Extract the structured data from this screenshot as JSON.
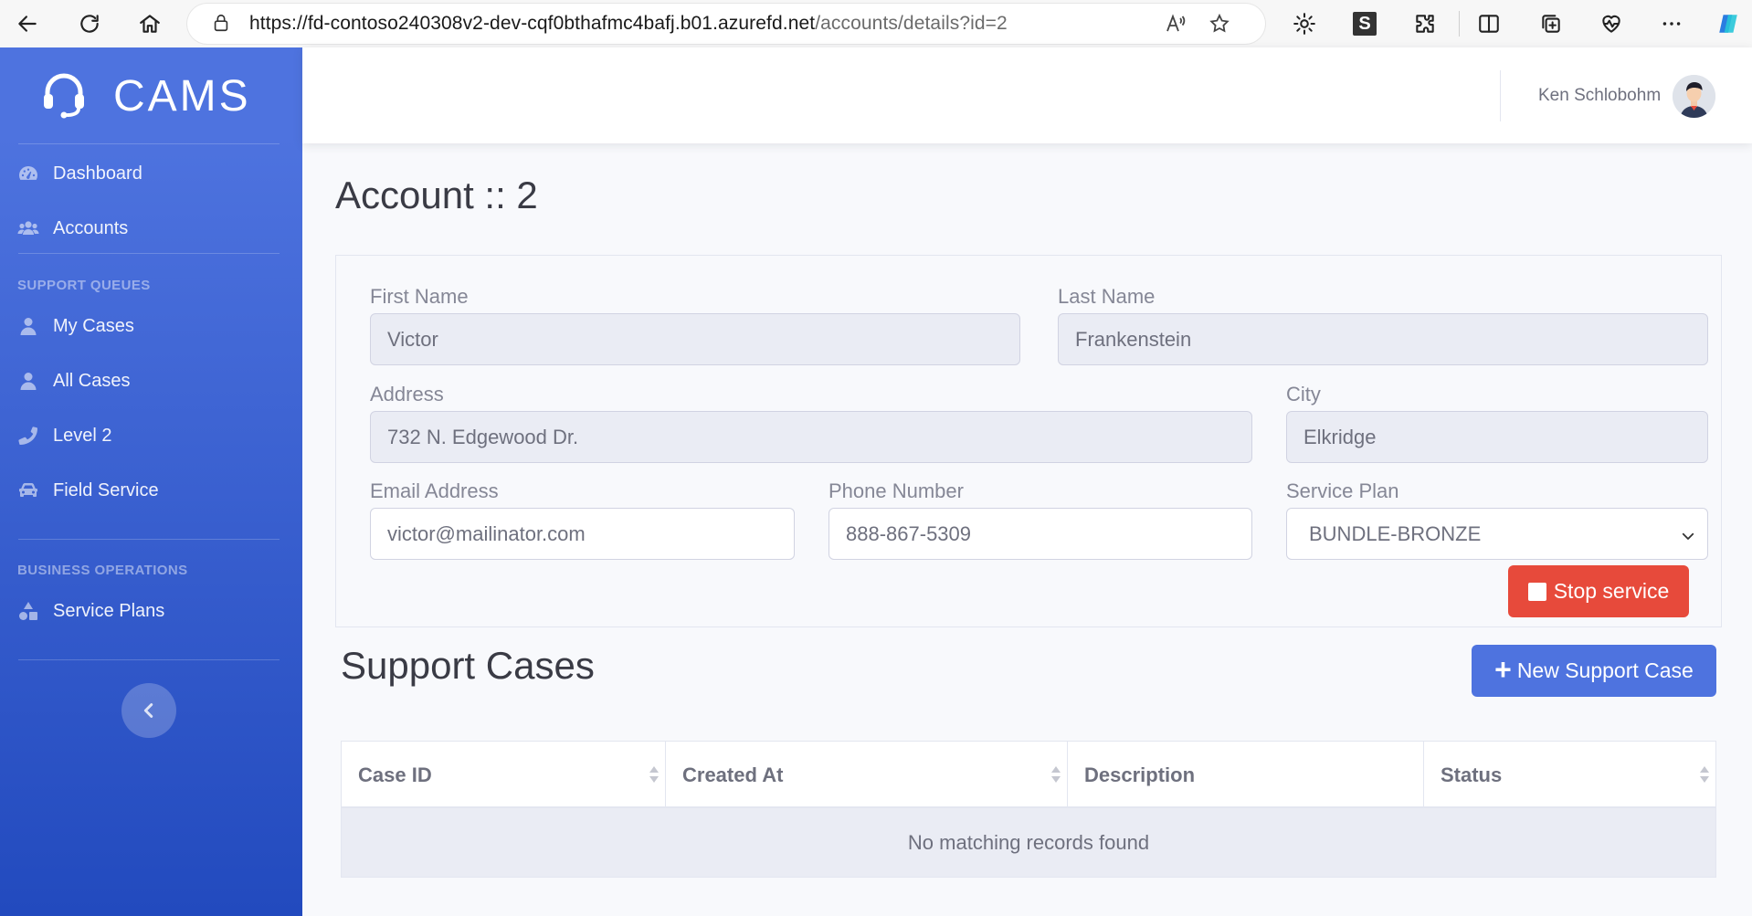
{
  "browser": {
    "url_host": "https://fd-contoso240308v2-dev-cqf0bthafmc4bafj.b01.azurefd.net",
    "url_path": "/accounts/details?id=2",
    "s_extension_label": "S"
  },
  "sidebar": {
    "brand": "CAMS",
    "items": [
      {
        "label": "Dashboard",
        "icon": "tachometer-icon"
      },
      {
        "label": "Accounts",
        "icon": "users-icon"
      }
    ],
    "support_heading": "SUPPORT QUEUES",
    "support_items": [
      {
        "label": "My Cases",
        "icon": "user-icon"
      },
      {
        "label": "All Cases",
        "icon": "user-icon"
      },
      {
        "label": "Level 2",
        "icon": "phone-icon"
      },
      {
        "label": "Field Service",
        "icon": "car-icon"
      }
    ],
    "business_heading": "BUSINESS OPERATIONS",
    "business_items": [
      {
        "label": "Service Plans",
        "icon": "shapes-icon"
      }
    ]
  },
  "topbar": {
    "user_name": "Ken Schlobohm"
  },
  "page": {
    "title": "Account :: 2"
  },
  "form": {
    "first_name_label": "First Name",
    "first_name_value": "Victor",
    "last_name_label": "Last Name",
    "last_name_value": "Frankenstein",
    "address_label": "Address",
    "address_value": "732 N. Edgewood Dr.",
    "city_label": "City",
    "city_value": "Elkridge",
    "email_label": "Email Address",
    "email_value": "victor@mailinator.com",
    "phone_label": "Phone Number",
    "phone_value": "888-867-5309",
    "plan_label": "Service Plan",
    "plan_value": "BUNDLE-BRONZE",
    "stop_button": "Stop service"
  },
  "cases": {
    "title": "Support Cases",
    "new_button": "New Support Case",
    "columns": [
      "Case ID",
      "Created At",
      "Description",
      "Status"
    ],
    "empty_message": "No matching records found"
  },
  "colors": {
    "primary": "#4e73df",
    "danger": "#e74a3b",
    "sidebar_gradient_end": "#224abe"
  }
}
